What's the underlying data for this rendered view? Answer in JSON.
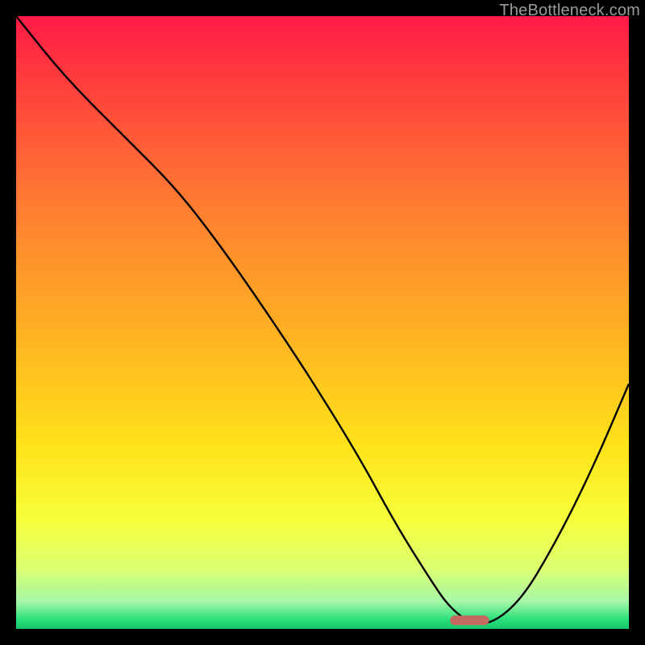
{
  "attribution": "TheBottleneck.com",
  "chart_data": {
    "type": "line",
    "title": "",
    "xlabel": "",
    "ylabel": "",
    "xlim": [
      0,
      100
    ],
    "ylim": [
      0,
      100
    ],
    "background_gradient": {
      "stops": [
        {
          "offset": 0.0,
          "color": "#ff1a46"
        },
        {
          "offset": 0.1,
          "color": "#ff3b3d"
        },
        {
          "offset": 0.3,
          "color": "#ff7a32"
        },
        {
          "offset": 0.52,
          "color": "#ffb222"
        },
        {
          "offset": 0.7,
          "color": "#ffe21a"
        },
        {
          "offset": 0.82,
          "color": "#f6ff3a"
        },
        {
          "offset": 0.9,
          "color": "#dcff70"
        },
        {
          "offset": 0.955,
          "color": "#a8f7a8"
        },
        {
          "offset": 0.985,
          "color": "#28e07a"
        },
        {
          "offset": 1.0,
          "color": "#14c76a"
        }
      ]
    },
    "series": [
      {
        "name": "bottleneck-curve",
        "x": [
          0,
          8,
          18,
          26,
          33,
          40,
          48,
          56,
          62,
          67,
          71,
          76,
          82,
          88,
          94,
          100
        ],
        "y": [
          100,
          90,
          80,
          72,
          63,
          53,
          41,
          28,
          17,
          9,
          3,
          0,
          4,
          14,
          26,
          40
        ]
      }
    ],
    "marker": {
      "x_center": 74,
      "x_halfwidth": 3.2,
      "y": 1.4,
      "color": "#c46a63"
    }
  }
}
